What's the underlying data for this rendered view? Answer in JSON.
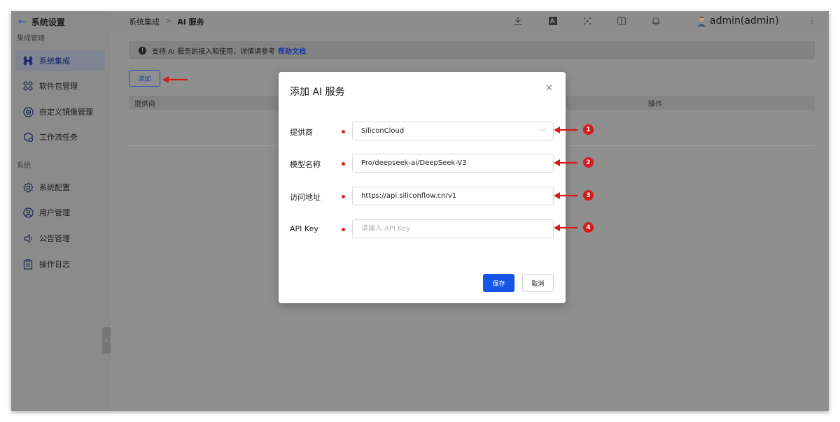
{
  "sidebar": {
    "back_title": "系统设置",
    "group1_title": "集成管理",
    "group2_title": "系统",
    "items": [
      {
        "label": "系统集成",
        "icon": "command-icon"
      },
      {
        "label": "软件包管理",
        "icon": "package-icon"
      },
      {
        "label": "自定义镜像管理",
        "icon": "image-icon"
      },
      {
        "label": "工作流任务",
        "icon": "workflow-icon"
      },
      {
        "label": "系统配置",
        "icon": "settings-icon"
      },
      {
        "label": "用户管理",
        "icon": "user-icon"
      },
      {
        "label": "公告管理",
        "icon": "speaker-icon"
      },
      {
        "label": "操作日志",
        "icon": "log-icon"
      }
    ]
  },
  "header": {
    "breadcrumb": [
      "系统集成",
      "AI 服务"
    ],
    "breadcrumb_sep": ">",
    "user": "admin(admin)"
  },
  "main": {
    "alert_text": "支持 AI 服务的接入和使用，详情请参考",
    "alert_link": "帮助文档",
    "add_label": "添加",
    "table_columns": [
      "提供商",
      "操作"
    ]
  },
  "dialog": {
    "title": "添加 AI 服务",
    "fields": [
      {
        "label": "提供商",
        "value": "SiliconCloud",
        "placeholder": "",
        "badge": "1"
      },
      {
        "label": "模型名称",
        "value": "Pro/deepseek-ai/DeepSeek-V3",
        "placeholder": "",
        "badge": "2"
      },
      {
        "label": "访问地址",
        "value": "https://api.siliconflow.cn/v1",
        "placeholder": "",
        "badge": "3"
      },
      {
        "label": "API Key",
        "value": "",
        "placeholder": "请输入 API Key",
        "badge": "4"
      }
    ],
    "save_label": "保存",
    "cancel_label": "取消"
  },
  "colors": {
    "primary": "#1554e6",
    "annotation_red": "#d41b1b"
  }
}
